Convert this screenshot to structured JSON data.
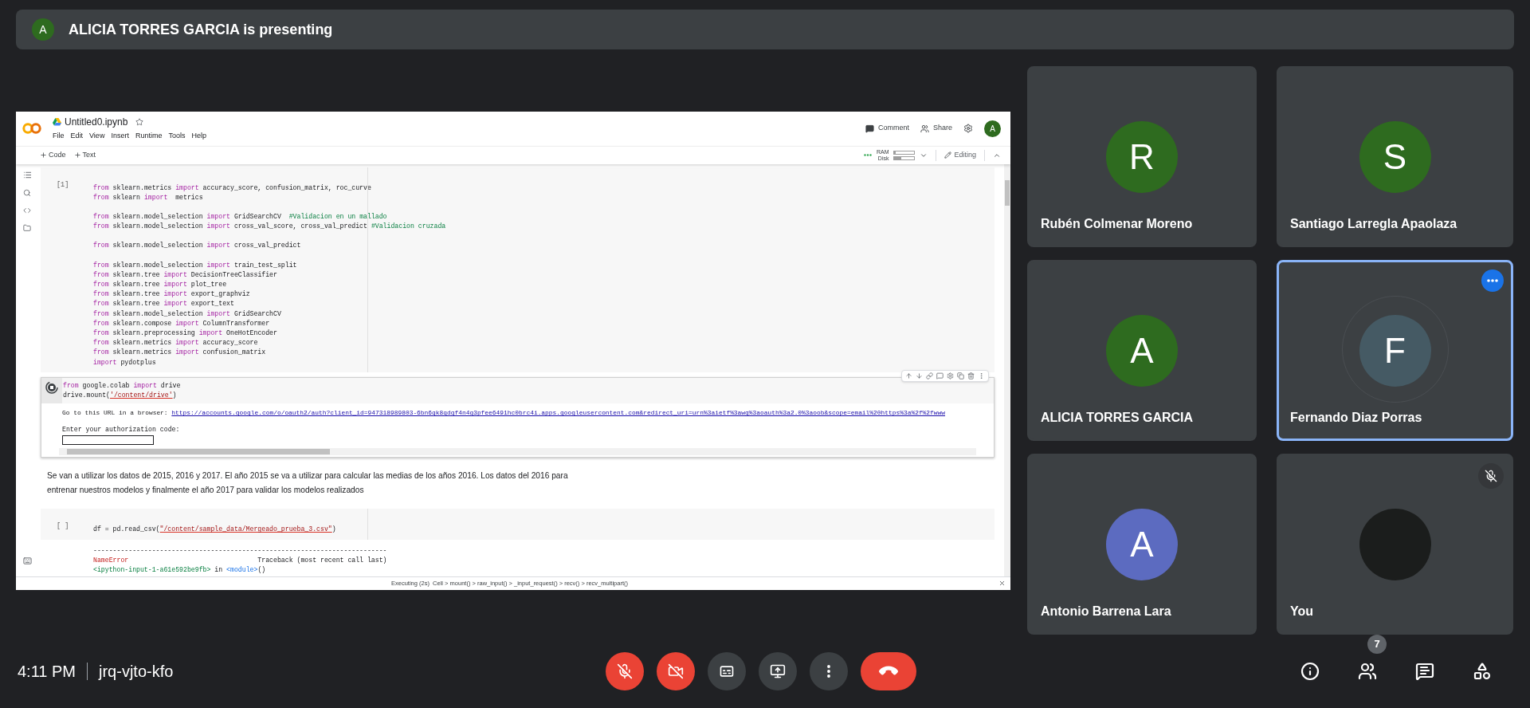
{
  "presenting_banner": {
    "avatar": "A",
    "text": "ALICIA TORRES GARCIA is presenting"
  },
  "shared_screen": {
    "notebook_title": "Untitled0.ipynb",
    "menu": [
      "File",
      "Edit",
      "View",
      "Insert",
      "Runtime",
      "Tools",
      "Help"
    ],
    "header_actions": [
      {
        "kind": "comment",
        "label": "Comment"
      },
      {
        "kind": "share",
        "label": "Share"
      }
    ],
    "account_avatar": "A",
    "toolbar": {
      "add_buttons": [
        {
          "label": "Code"
        },
        {
          "label": "Text"
        }
      ],
      "ram_meter": {
        "label": "RAM",
        "level": 0.05
      },
      "disk_meter": {
        "label": "Disk",
        "level": 0.35
      },
      "mode": "Editing"
    },
    "cells": [
      {
        "kind": "code",
        "prompt": "[1]",
        "blocks": [
          [
            [
              {
                "kind": "kw",
                "text": "from"
              },
              {
                "kind": "tx",
                "text": " sklearn.metrics "
              },
              {
                "kind": "kw",
                "text": "import"
              },
              {
                "kind": "tx",
                "text": " accuracy_score, confusion_matrix, roc_curve"
              }
            ],
            [
              {
                "kind": "kw",
                "text": "from"
              },
              {
                "kind": "tx",
                "text": " sklearn "
              },
              {
                "kind": "kw",
                "text": "import"
              },
              {
                "kind": "tx",
                "text": "  metrics"
              }
            ]
          ],
          [
            [
              {
                "kind": "kw",
                "text": "from"
              },
              {
                "kind": "tx",
                "text": " sklearn.model_selection "
              },
              {
                "kind": "kw",
                "text": "import"
              },
              {
                "kind": "tx",
                "text": " GridSearchCV  "
              },
              {
                "kind": "cm",
                "text": "#Validacion en un mallado"
              }
            ],
            [
              {
                "kind": "kw",
                "text": "from"
              },
              {
                "kind": "tx",
                "text": " sklearn.model_selection "
              },
              {
                "kind": "kw",
                "text": "import"
              },
              {
                "kind": "tx",
                "text": " cross_val_score, cross_val_predict "
              },
              {
                "kind": "cm",
                "text": "#Validacion cruzada"
              }
            ]
          ],
          [
            [
              {
                "kind": "kw",
                "text": "from"
              },
              {
                "kind": "tx",
                "text": " sklearn.model_selection "
              },
              {
                "kind": "kw",
                "text": "import"
              },
              {
                "kind": "tx",
                "text": " cross_val_predict"
              }
            ]
          ],
          [
            [
              {
                "kind": "kw",
                "text": "from"
              },
              {
                "kind": "tx",
                "text": " sklearn.model_selection "
              },
              {
                "kind": "kw",
                "text": "import"
              },
              {
                "kind": "tx",
                "text": " train_test_split"
              }
            ],
            [
              {
                "kind": "kw",
                "text": "from"
              },
              {
                "kind": "tx",
                "text": " sklearn.tree "
              },
              {
                "kind": "kw",
                "text": "import"
              },
              {
                "kind": "tx",
                "text": " DecisionTreeClassifier"
              }
            ],
            [
              {
                "kind": "kw",
                "text": "from"
              },
              {
                "kind": "tx",
                "text": " sklearn.tree "
              },
              {
                "kind": "kw",
                "text": "import"
              },
              {
                "kind": "tx",
                "text": " plot_tree"
              }
            ],
            [
              {
                "kind": "kw",
                "text": "from"
              },
              {
                "kind": "tx",
                "text": " sklearn.tree "
              },
              {
                "kind": "kw",
                "text": "import"
              },
              {
                "kind": "tx",
                "text": " export_graphviz"
              }
            ],
            [
              {
                "kind": "kw",
                "text": "from"
              },
              {
                "kind": "tx",
                "text": " sklearn.tree "
              },
              {
                "kind": "kw",
                "text": "import"
              },
              {
                "kind": "tx",
                "text": " export_text"
              }
            ],
            [
              {
                "kind": "kw",
                "text": "from"
              },
              {
                "kind": "tx",
                "text": " sklearn.model_selection "
              },
              {
                "kind": "kw",
                "text": "import"
              },
              {
                "kind": "tx",
                "text": " GridSearchCV"
              }
            ],
            [
              {
                "kind": "kw",
                "text": "from"
              },
              {
                "kind": "tx",
                "text": " sklearn.compose "
              },
              {
                "kind": "kw",
                "text": "import"
              },
              {
                "kind": "tx",
                "text": " ColumnTransformer"
              }
            ],
            [
              {
                "kind": "kw",
                "text": "from"
              },
              {
                "kind": "tx",
                "text": " sklearn.preprocessing "
              },
              {
                "kind": "kw",
                "text": "import"
              },
              {
                "kind": "tx",
                "text": " OneHotEncoder"
              }
            ],
            [
              {
                "kind": "kw",
                "text": "from"
              },
              {
                "kind": "tx",
                "text": " sklearn.metrics "
              },
              {
                "kind": "kw",
                "text": "import"
              },
              {
                "kind": "tx",
                "text": " accuracy_score"
              }
            ],
            [
              {
                "kind": "kw",
                "text": "from"
              },
              {
                "kind": "tx",
                "text": " sklearn.metrics "
              },
              {
                "kind": "kw",
                "text": "import"
              },
              {
                "kind": "tx",
                "text": " confusion_matrix"
              }
            ],
            [
              {
                "kind": "kw",
                "text": "import"
              },
              {
                "kind": "tx",
                "text": " pydotplus"
              }
            ]
          ]
        ]
      },
      {
        "kind": "running",
        "blocks": [
          [
            [
              {
                "kind": "kw",
                "text": "from"
              },
              {
                "kind": "tx",
                "text": " google.colab "
              },
              {
                "kind": "kw",
                "text": "import"
              },
              {
                "kind": "tx",
                "text": " drive"
              }
            ],
            [
              {
                "kind": "tx",
                "text": "drive.mount("
              },
              {
                "kind": "str",
                "text": "'/content/drive'"
              },
              {
                "kind": "tx",
                "text": ")"
              }
            ]
          ]
        ],
        "output": {
          "url_prefix": "Go to this URL in a browser: ",
          "url": "https://accounts.google.com/o/oauth2/auth?client_id=947318989803-6bn6qk8qdgf4n4g3pfee6491hc0brc4i.apps.googleusercontent.com&redirect_uri=urn%3aietf%3awg%3aoauth%3a2.0%3aoob&scope=email%20https%3a%2f%2fwww",
          "prompt": "Enter your authorization code:"
        }
      },
      {
        "kind": "text",
        "text": "Se van a utilizar los datos de 2015, 2016 y 2017. El año 2015 se va a utilizar para calcular las medias de los años 2016. Los datos del 2016 para entrenar nuestros modelos y finalmente el año 2017 para validar los modelos realizados"
      },
      {
        "kind": "code",
        "prompt": "[ ]",
        "blocks": [
          [
            [
              {
                "kind": "tx",
                "text": "df = pd.read_csv("
              },
              {
                "kind": "str",
                "text": "\"/content/sample_data/Mergeado_prueba_3.csv\""
              },
              {
                "kind": "tx",
                "text": ")"
              }
            ]
          ]
        ],
        "output_lines": [
          [
            {
              "kind": "tx",
              "text": "---------------------------------------------------------------------------"
            }
          ],
          [
            {
              "kind": "err",
              "text": "NameError"
            },
            {
              "kind": "tx",
              "text": "                                 Traceback (most recent call last)"
            }
          ],
          [
            {
              "kind": "path",
              "text": "<ipython-input-1-a61e592be9fb>"
            },
            {
              "kind": "tx",
              "text": " in "
            },
            {
              "kind": "mod",
              "text": "<module>"
            },
            {
              "kind": "tx",
              "text": "()"
            }
          ]
        ]
      }
    ],
    "status_bar": "Executing (2s)  Cell > mount() > raw_input() > _input_request() > recv() > recv_multipart()"
  },
  "participants": [
    {
      "kind": "initial",
      "initial": "R",
      "color": "#2e6b1f",
      "name": "Rubén Colmenar Moreno",
      "selected": false,
      "muted": false
    },
    {
      "kind": "initial",
      "initial": "S",
      "color": "#2e6b1f",
      "name": "Santiago Larregla Apaolaza",
      "selected": false,
      "muted": false
    },
    {
      "kind": "initial",
      "initial": "A",
      "color": "#2e6b1f",
      "name": "ALICIA TORRES GARCIA",
      "selected": false,
      "muted": false
    },
    {
      "kind": "initial",
      "initial": "F",
      "color": "#455a64",
      "name": "Fernando Diaz Porras",
      "selected": true,
      "muted": false
    },
    {
      "kind": "initial",
      "initial": "A",
      "color": "#5c6bc0",
      "name": "Antonio Barrena Lara",
      "selected": false,
      "muted": false
    },
    {
      "kind": "photo",
      "name": "You",
      "selected": false,
      "muted": true
    }
  ],
  "bottom_bar": {
    "time": "4:11 PM",
    "meeting_code": "jrq-vjto-kfo",
    "controls": [
      {
        "kind": "mic",
        "on": false
      },
      {
        "kind": "camera",
        "on": false
      },
      {
        "kind": "captions",
        "on": false
      },
      {
        "kind": "present"
      },
      {
        "kind": "more"
      },
      {
        "kind": "leave"
      }
    ],
    "side_buttons": [
      {
        "kind": "info"
      },
      {
        "kind": "people",
        "badge": "7"
      },
      {
        "kind": "chat"
      },
      {
        "kind": "activities"
      }
    ]
  }
}
